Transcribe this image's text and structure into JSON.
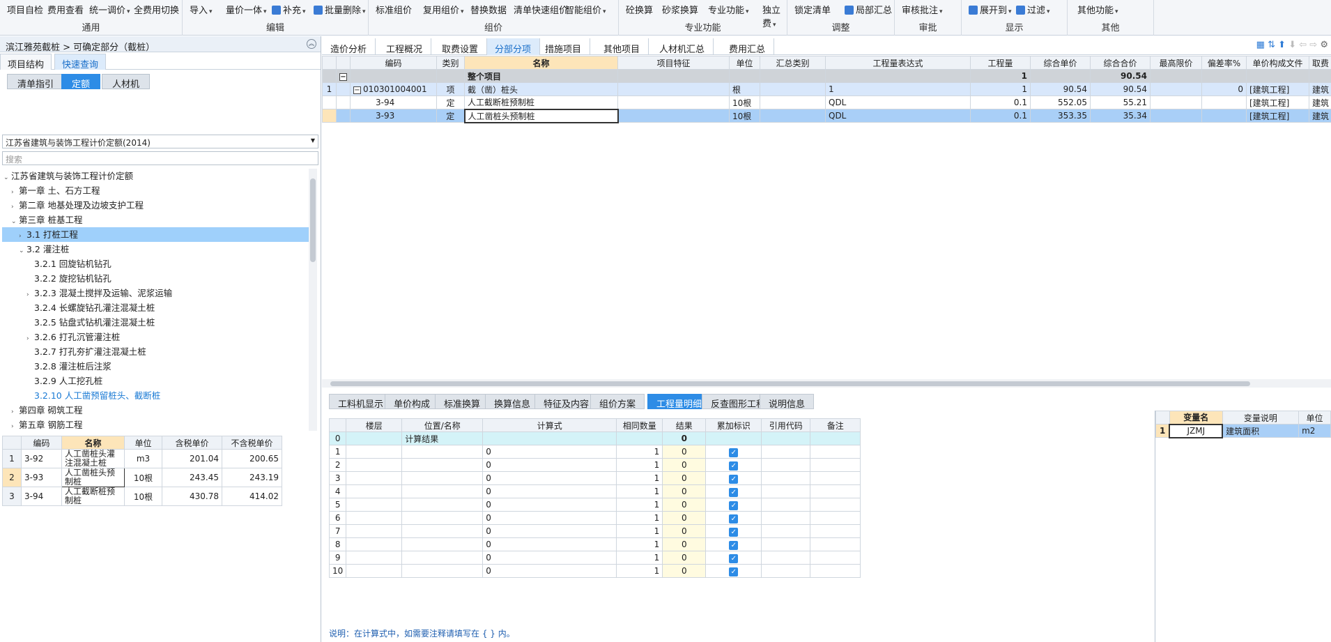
{
  "ribbon": {
    "groups": [
      {
        "label": "通用",
        "buttons": [
          "项目自检",
          "费用查看",
          "统一调价",
          "全费用切换"
        ]
      },
      {
        "label": "编辑",
        "buttons": [
          "导入",
          "量价一体",
          "补充",
          "批量删除"
        ]
      },
      {
        "label": "组价",
        "buttons": [
          "标准组价",
          "复用组价",
          "替换数据",
          "清单快速组价",
          "智能组价"
        ]
      },
      {
        "label": "专业功能",
        "buttons": [
          "砼换算",
          "砂浆换算",
          "专业功能",
          "独立费"
        ]
      },
      {
        "label": "调整",
        "buttons": [
          "锁定清单",
          "局部汇总"
        ]
      },
      {
        "label": "审批",
        "buttons": [
          "审核批注"
        ]
      },
      {
        "label": "显示",
        "buttons": [
          "展开到",
          "过滤"
        ]
      },
      {
        "label": "其他",
        "buttons": [
          "其他功能"
        ]
      }
    ]
  },
  "left": {
    "title": "滨江雅苑截桩 > 可确定部分（截桩）",
    "tabs": [
      "项目结构",
      "快速查询"
    ],
    "subtabs": [
      "清单指引",
      "定额",
      "人材机"
    ],
    "quota": "江苏省建筑与装饰工程计价定额(2014)",
    "search_placeholder": "搜索",
    "tree": [
      {
        "label": "江苏省建筑与装饰工程计价定额",
        "indent": 0,
        "tog": "v"
      },
      {
        "label": "第一章  土、石方工程",
        "indent": 1,
        "tog": ">"
      },
      {
        "label": "第二章  地基处理及边坡支护工程",
        "indent": 1,
        "tog": ">"
      },
      {
        "label": "第三章  桩基工程",
        "indent": 1,
        "tog": "v"
      },
      {
        "label": "3.1  打桩工程",
        "indent": 2,
        "tog": ">",
        "sel": true
      },
      {
        "label": "3.2  灌注桩",
        "indent": 2,
        "tog": "v"
      },
      {
        "label": "3.2.1  回旋钻机钻孔",
        "indent": 3,
        "tog": ""
      },
      {
        "label": "3.2.2  旋挖钻机钻孔",
        "indent": 3,
        "tog": ""
      },
      {
        "label": "3.2.3  混凝土搅拌及运输、泥浆运输",
        "indent": 3,
        "tog": ">"
      },
      {
        "label": "3.2.4  长螺旋钻孔灌注混凝土桩",
        "indent": 3,
        "tog": ""
      },
      {
        "label": "3.2.5  钻盘式钻机灌注混凝土桩",
        "indent": 3,
        "tog": ""
      },
      {
        "label": "3.2.6  打孔沉管灌注桩",
        "indent": 3,
        "tog": ">"
      },
      {
        "label": "3.2.7  打孔夯扩灌注混凝土桩",
        "indent": 3,
        "tog": ""
      },
      {
        "label": "3.2.8  灌注桩后注浆",
        "indent": 3,
        "tog": ""
      },
      {
        "label": "3.2.9  人工挖孔桩",
        "indent": 3,
        "tog": ""
      },
      {
        "label": "3.2.10  人工凿预留桩头、截断桩",
        "indent": 3,
        "tog": "",
        "link": true
      },
      {
        "label": "第四章  砌筑工程",
        "indent": 1,
        "tog": ">"
      },
      {
        "label": "第五章  钢筋工程",
        "indent": 1,
        "tog": ">"
      }
    ],
    "grid_headers": [
      "",
      "编码",
      "名称",
      "单位",
      "含税单价",
      "不含税单价"
    ],
    "grid_rows": [
      [
        "1",
        "3-92",
        "人工凿桩头灌注混凝土桩",
        "m3",
        "201.04",
        "200.65"
      ],
      [
        "2",
        "3-93",
        "人工凿桩头预制桩",
        "10根",
        "243.45",
        "243.19"
      ],
      [
        "3",
        "3-94",
        "人工截断桩预制桩",
        "10根",
        "430.78",
        "414.02"
      ]
    ]
  },
  "main": {
    "tabs": [
      "造价分析",
      "工程概况",
      "取费设置",
      "分部分项",
      "措施项目",
      "其他项目",
      "人材机汇总",
      "费用汇总"
    ],
    "headers": [
      "",
      "",
      "编码",
      "类别",
      "名称",
      "项目特征",
      "单位",
      "汇总类别",
      "工程量表达式",
      "工程量",
      "综合单价",
      "综合合价",
      "最高限价",
      "偏差率%",
      "单价构成文件",
      "取费"
    ],
    "summary": {
      "name": "整个项目",
      "qty": "1",
      "total": "90.54"
    },
    "rows": [
      {
        "no": "1",
        "code": "010301004001",
        "type": "项",
        "name": "截（凿）桩头",
        "unit": "根",
        "expr": "1",
        "qty": "1",
        "price": "90.54",
        "total": "90.54",
        "dev": "0",
        "file": "[建筑工程]",
        "fee": "建筑"
      },
      {
        "no": "",
        "code": "3-94",
        "type": "定",
        "name": "人工截断桩预制桩",
        "unit": "10根",
        "expr": "QDL",
        "qty": "0.1",
        "price": "552.05",
        "total": "55.21",
        "dev": "",
        "file": "[建筑工程]",
        "fee": "建筑"
      },
      {
        "no": "",
        "code": "3-93",
        "type": "定",
        "name": "人工凿桩头预制桩",
        "unit": "10根",
        "expr": "QDL",
        "qty": "0.1",
        "price": "353.35",
        "total": "35.34",
        "dev": "",
        "file": "[建筑工程]",
        "fee": "建筑"
      }
    ]
  },
  "bottom": {
    "tabs": [
      "工料机显示",
      "单价构成",
      "标准换算",
      "换算信息",
      "特征及内容",
      "组价方案",
      "工程量明细",
      "反查图形工程量",
      "说明信息"
    ],
    "headers": [
      "",
      "楼层",
      "位置/名称",
      "计算式",
      "相同数量",
      "结果",
      "累加标识",
      "引用代码",
      "备注"
    ],
    "calc_row": {
      "name": "计算结果",
      "result": "0"
    },
    "rows": [
      "1",
      "2",
      "3",
      "4",
      "5",
      "6",
      "7",
      "8",
      "9",
      "10"
    ],
    "row_formula": "0",
    "row_count": "1",
    "row_result": "0",
    "note": "说明：在计算式中，如需要注释请填写在 { } 内。",
    "var_headers": [
      "",
      "变量名",
      "变量说明",
      "单位"
    ],
    "var_row": [
      "1",
      "JZMJ",
      "建筑面积",
      "m2"
    ]
  }
}
